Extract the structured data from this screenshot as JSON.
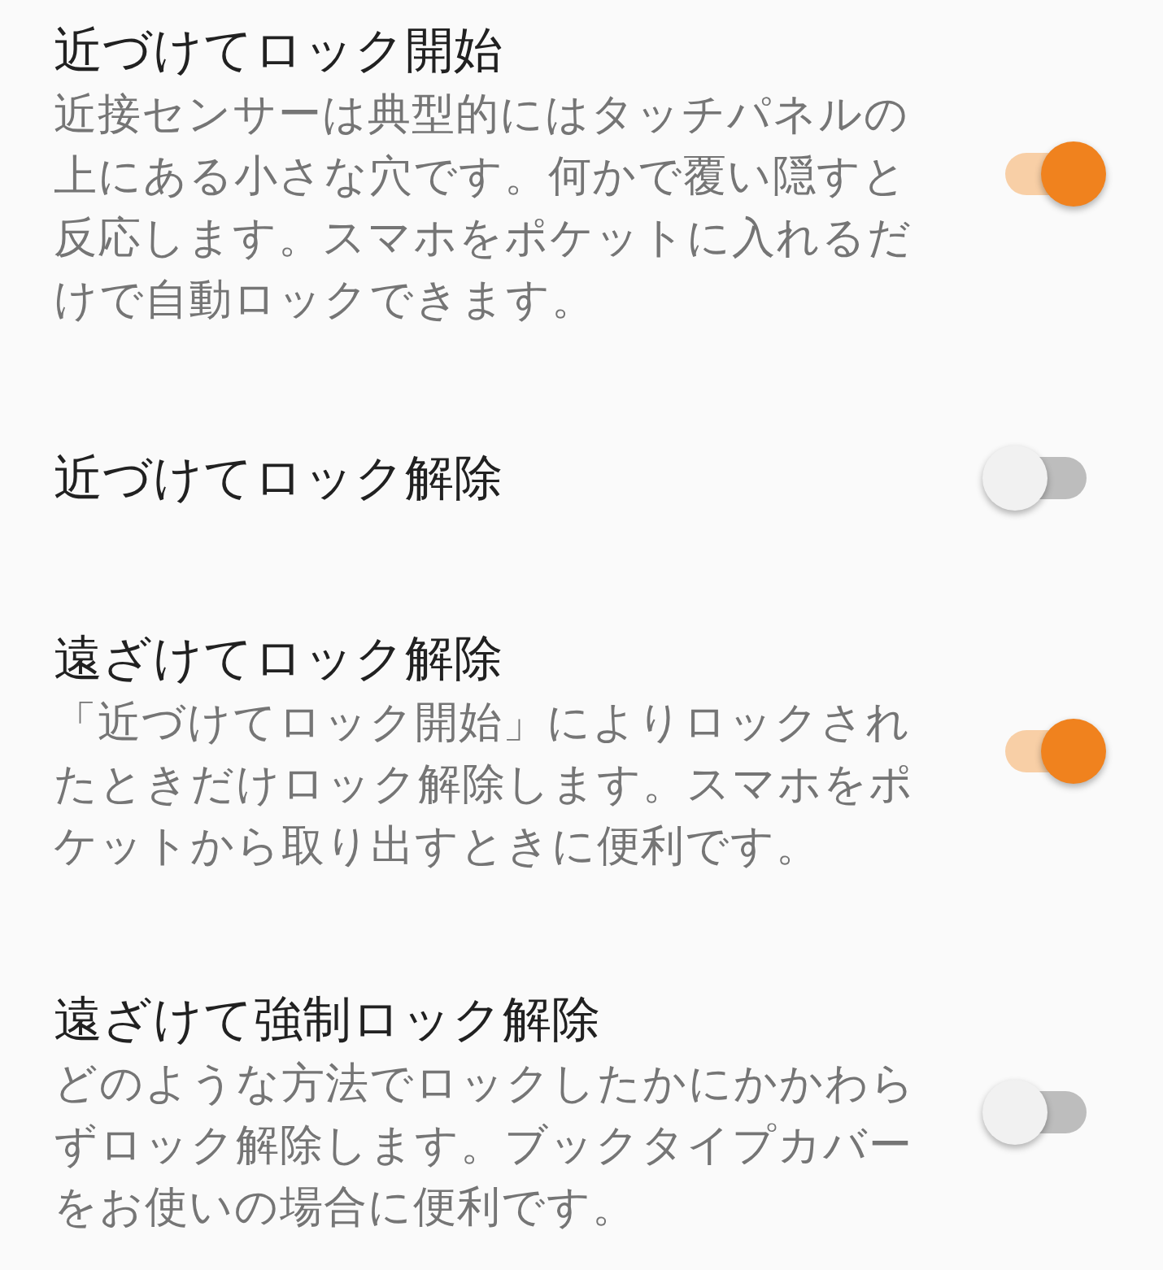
{
  "settings": [
    {
      "title": "近づけてロック開始",
      "description": "近接センサーは典型的にはタッチパネルの上にある小さな穴です。何かで覆い隠すと反応します。スマホをポケットに入れるだけで自動ロックできます。",
      "on": true
    },
    {
      "title": "近づけてロック解除",
      "on": false
    },
    {
      "title": "遠ざけてロック解除",
      "description": "「近づけてロック開始」によりロックされたときだけロック解除します。スマホをポケットから取り出すときに便利です。",
      "on": true
    },
    {
      "title": "遠ざけて強制ロック解除",
      "description": "どのような方法でロックしたかにかかわらずロック解除します。ブックタイプカバーをお使いの場合に便利です。",
      "on": false
    }
  ]
}
